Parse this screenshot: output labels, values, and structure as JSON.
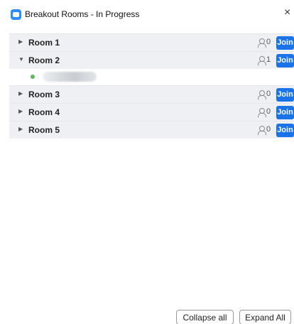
{
  "window": {
    "title": "Breakout Rooms - In Progress",
    "close_glyph": "×"
  },
  "rooms": [
    {
      "name": "Room 1",
      "count": "0",
      "expanded": false,
      "join_label": "Join"
    },
    {
      "name": "Room 2",
      "count": "1",
      "expanded": true,
      "join_label": "Join",
      "participants": [
        {
          "status_color": "#5cb85c"
        }
      ]
    },
    {
      "name": "Room 3",
      "count": "0",
      "expanded": false,
      "join_label": "Join"
    },
    {
      "name": "Room 4",
      "count": "0",
      "expanded": false,
      "join_label": "Join"
    },
    {
      "name": "Room 5",
      "count": "0",
      "expanded": false,
      "join_label": "Join"
    }
  ],
  "footer": {
    "collapse_label": "Collapse all",
    "expand_label": "Expand All"
  },
  "colors": {
    "join": "#1a73e8",
    "row_bg": "#eef0f3",
    "app_icon": "#2d8cff"
  }
}
